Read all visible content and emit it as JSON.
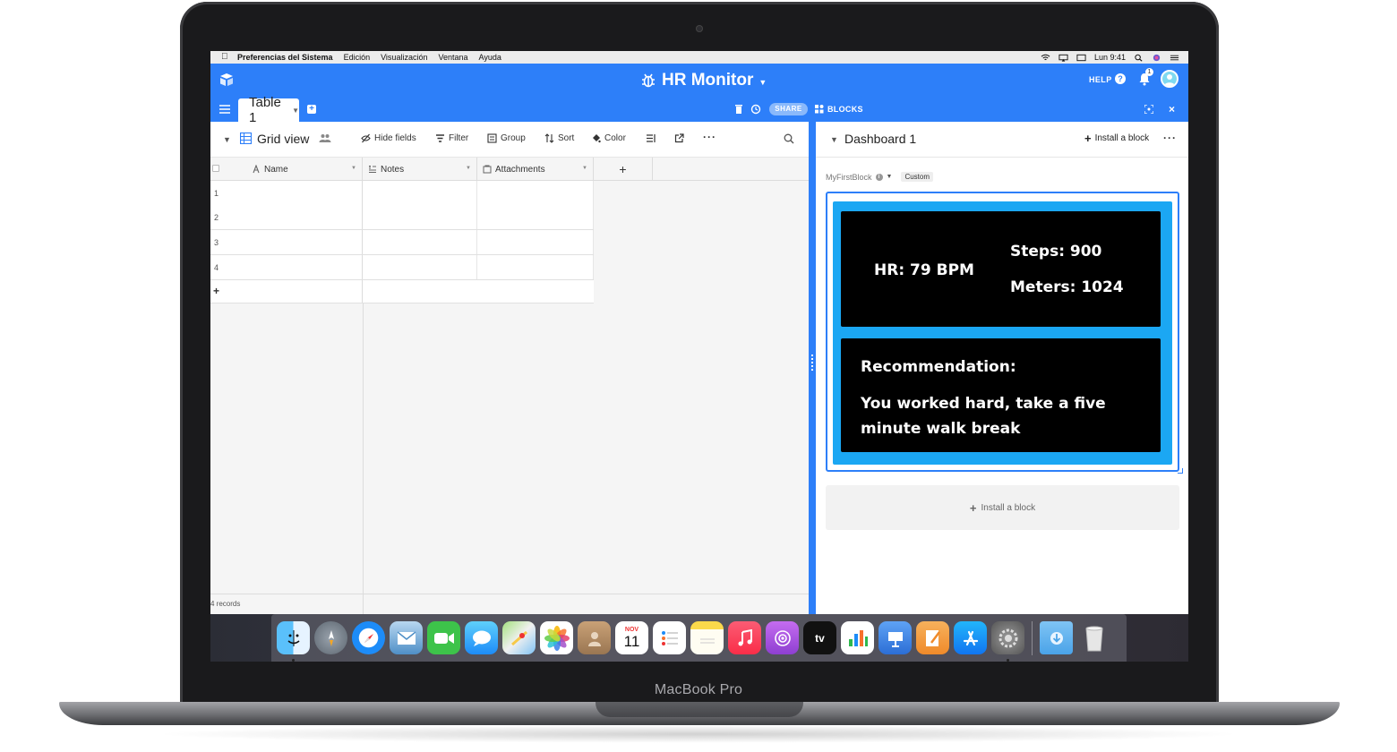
{
  "device": {
    "label": "MacBook Pro"
  },
  "menubar": {
    "app_name": "Preferencias del Sistema",
    "items": [
      "Edición",
      "Visualización",
      "Ventana",
      "Ayuda"
    ],
    "clock": "Lun 9:41"
  },
  "appbar": {
    "base_title": "HR Monitor",
    "help_label": "HELP",
    "notification_count": "1",
    "accent_color": "#2d7ff9"
  },
  "tabbar": {
    "table_tab": "Table 1",
    "share_label": "SHARE",
    "blocks_label": "BLOCKS"
  },
  "view_toolbar": {
    "view_name": "Grid view",
    "hide_fields": "Hide fields",
    "filter": "Filter",
    "group": "Group",
    "sort": "Sort",
    "color": "Color"
  },
  "grid": {
    "columns": [
      "Name",
      "Notes",
      "Attachments"
    ],
    "row_numbers": [
      "1",
      "2",
      "3",
      "4"
    ],
    "add_row": "+",
    "add_column": "+",
    "record_count": "4 records"
  },
  "dashboard": {
    "title": "Dashboard 1",
    "install_block_top": "Install a block",
    "block_name": "MyFirstBlock",
    "block_badge": "Custom",
    "install_block_bottom": "Install a block",
    "hr": "HR: 79 BPM",
    "steps": "Steps: 900",
    "meters": "Meters: 1024",
    "recommendation_title": "Recommendation:",
    "recommendation_text": "You worked hard, take a five minute walk break",
    "block_bg_color": "#1ba7f3"
  },
  "dock": {
    "apps": [
      "finder-icon",
      "launchpad-icon",
      "safari-icon",
      "mail-icon",
      "facetime-icon",
      "messages-icon",
      "maps-icon",
      "photos-icon",
      "contacts-icon",
      "calendar-icon",
      "reminders-icon",
      "notes-icon",
      "music-icon",
      "podcasts-icon",
      "appletv-icon",
      "numbers-icon",
      "keynote-icon",
      "pages-icon",
      "appstore-icon",
      "systemprefs-icon"
    ],
    "calendar_month": "NOV",
    "calendar_day": "11",
    "tv_label": "tv"
  }
}
